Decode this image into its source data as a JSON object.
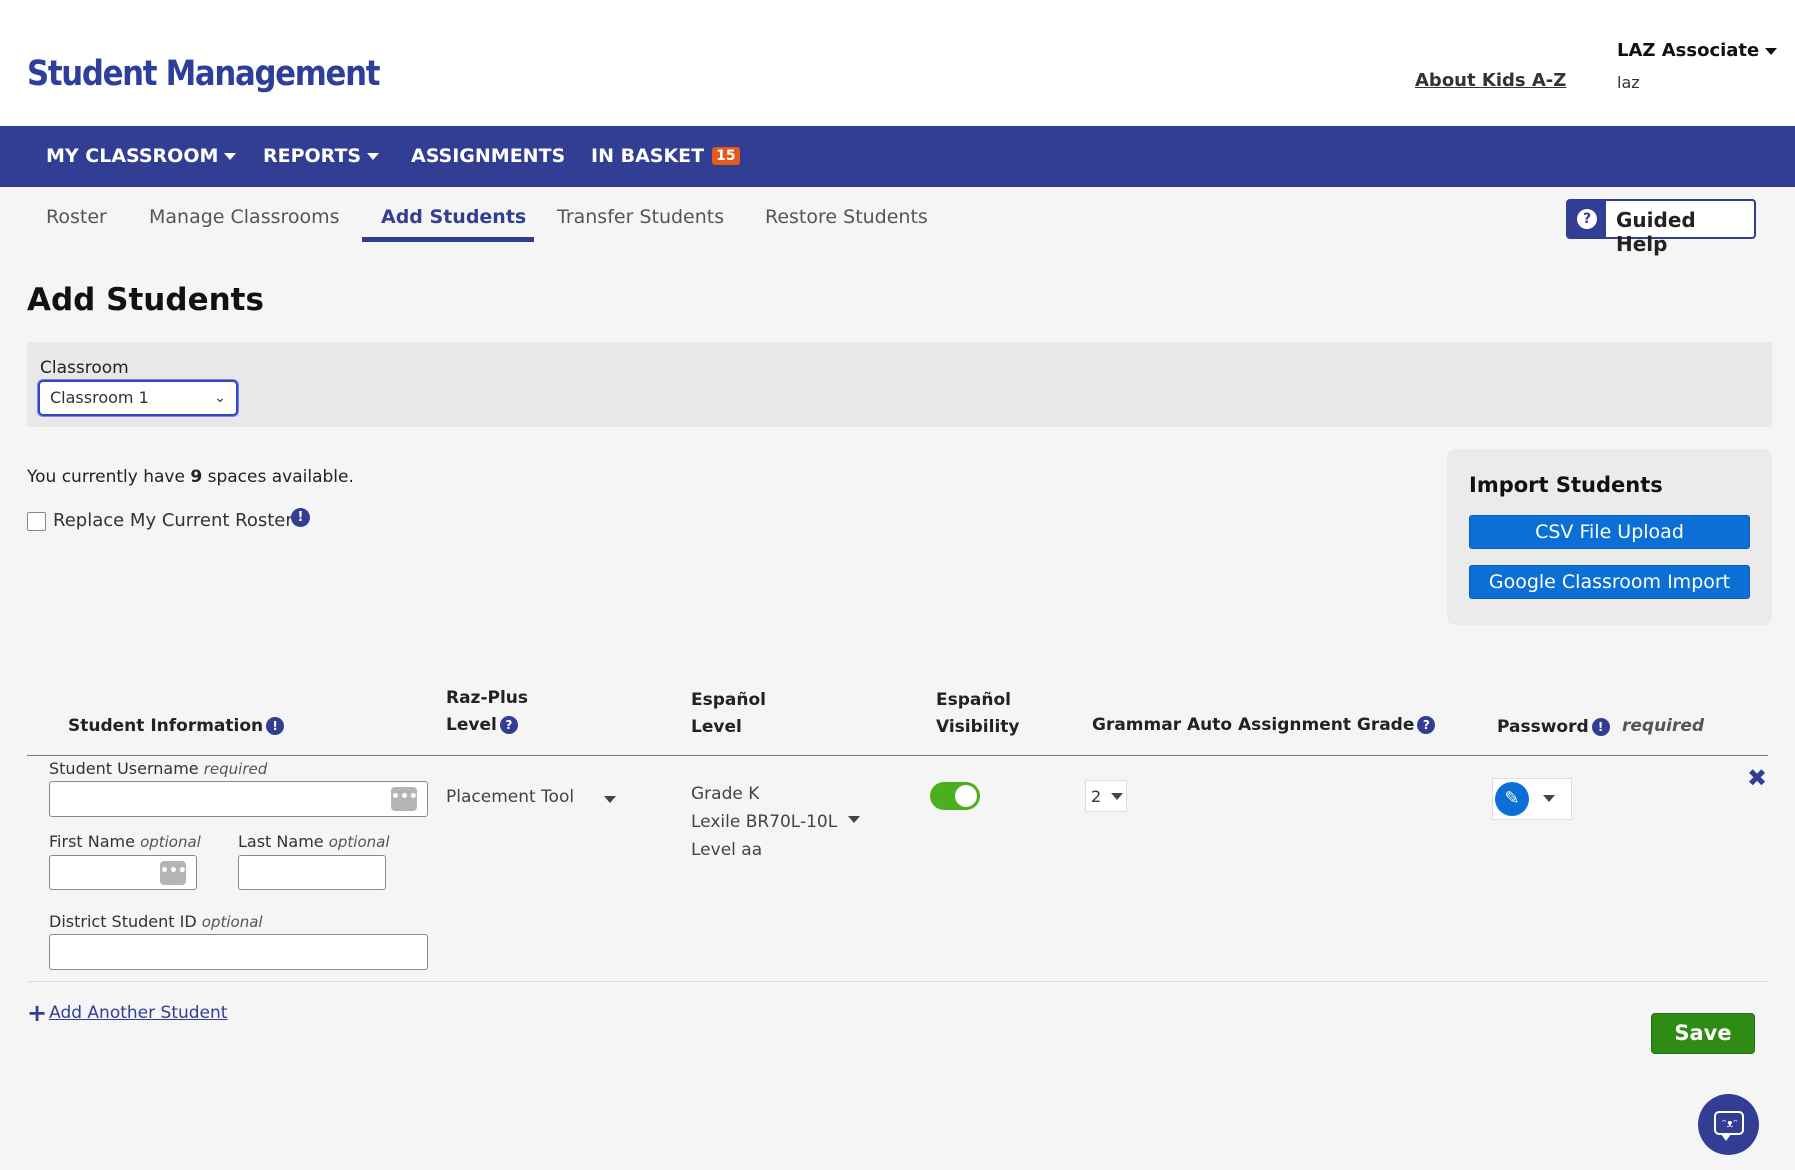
{
  "header": {
    "logo": "Student Management",
    "about_link": "About Kids A-Z",
    "account_name": "LAZ Associate",
    "account_sub": "laz"
  },
  "nav": {
    "items": [
      {
        "label": "MY CLASSROOM",
        "has_dropdown": true
      },
      {
        "label": "REPORTS",
        "has_dropdown": true
      },
      {
        "label": "ASSIGNMENTS",
        "has_dropdown": false
      },
      {
        "label": "IN BASKET",
        "has_dropdown": false,
        "badge": "15"
      }
    ]
  },
  "subtabs": {
    "items": [
      {
        "label": "Roster"
      },
      {
        "label": "Manage Classrooms"
      },
      {
        "label": "Add Students",
        "active": true
      },
      {
        "label": "Transfer Students"
      },
      {
        "label": "Restore Students"
      }
    ],
    "guided_help": "Guided Help",
    "guided_help_icon": "?"
  },
  "page": {
    "title": "Add Students",
    "classroom_label": "Classroom",
    "classroom_value": "Classroom 1",
    "spaces_prefix": "You currently have ",
    "spaces_count": "9",
    "spaces_suffix": " spaces available.",
    "replace_roster_label": "Replace My Current Roster",
    "info_glyph": "!"
  },
  "import": {
    "title": "Import Students",
    "csv_button": "CSV File Upload",
    "google_button": "Google Classroom Import"
  },
  "table": {
    "headers": {
      "student_info": "Student Information",
      "raz_line1": "Raz-Plus",
      "raz_line2": "Level",
      "esp_level_line1": "Español",
      "esp_level_line2": "Level",
      "esp_vis_line1": "Español",
      "esp_vis_line2": "Visibility",
      "grammar": "Grammar Auto Assignment Grade",
      "password": "Password",
      "password_required": "required",
      "help_glyph": "?",
      "info_glyph": "!"
    },
    "row": {
      "username_label": "Student Username",
      "username_note": "required",
      "first_name_label": "First Name",
      "first_name_note": "optional",
      "last_name_label": "Last Name",
      "last_name_note": "optional",
      "district_id_label": "District Student ID",
      "district_id_note": "optional",
      "username_value": "",
      "first_name_value": "",
      "last_name_value": "",
      "district_id_value": "",
      "dots_glyph": "•••",
      "raz_level": "Placement Tool",
      "esp_grade": "Grade K",
      "esp_lexile": "Lexile BR70L-10L",
      "esp_level": "Level aa",
      "esp_visibility_on": true,
      "grammar_grade": "2",
      "pencil_glyph": "✎",
      "remove_glyph": "✖"
    }
  },
  "actions": {
    "add_another_plus": "+",
    "add_another": "Add Another Student",
    "save": "Save"
  },
  "chat": {
    "face_glyph": "ᵔᴥᵔ"
  },
  "colors": {
    "brand_navy": "#313e93",
    "primary_blue": "#0b6fd6",
    "save_green": "#2e8b13",
    "toggle_green": "#4caf1d",
    "badge_orange": "#e35a1a"
  }
}
